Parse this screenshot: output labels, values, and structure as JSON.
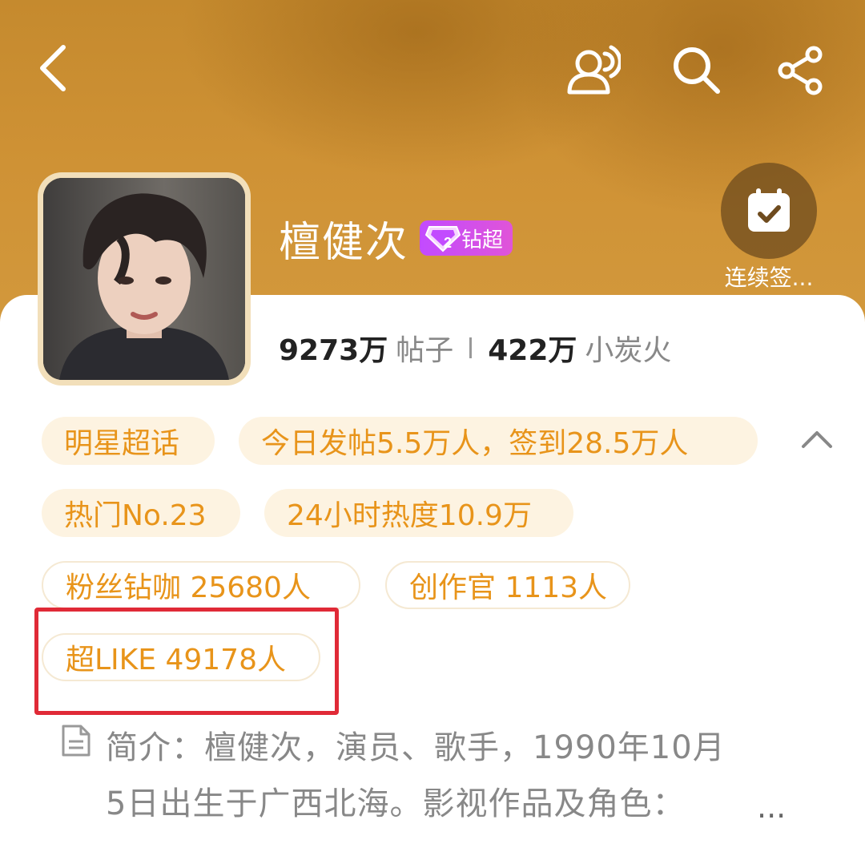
{
  "header": {
    "back_icon": "chevron-left-icon",
    "voice_icon": "voice-room-icon",
    "search_icon": "search-icon",
    "share_icon": "share-icon"
  },
  "profile": {
    "title": "檀健次",
    "badge_label": "钻超",
    "badge_level": "2",
    "checkin_label": "连续签..."
  },
  "stats": {
    "posts_value": "9273万",
    "posts_label": "帖子",
    "fans_value": "422万",
    "fans_label": "小炭火"
  },
  "chips": {
    "category": "明星超话",
    "daily": "今日发帖5.5万人，签到28.5万人",
    "rank": "热门No.23",
    "heat": "24小时热度10.9万",
    "diamond": "粉丝钻咖 25680人",
    "creator": "创作官 1113人",
    "superlike": "超LIKE 49178人"
  },
  "intro": {
    "line1": "简介：檀健次，演员、歌手，1990年10月",
    "line2": "5日出生于广西北海。影视作品及角色：",
    "more": "..."
  },
  "colors": {
    "accent": "#e8941a",
    "chip_bg": "#fdf3e1",
    "highlight": "#e02a37",
    "badge": "#c24bff"
  }
}
